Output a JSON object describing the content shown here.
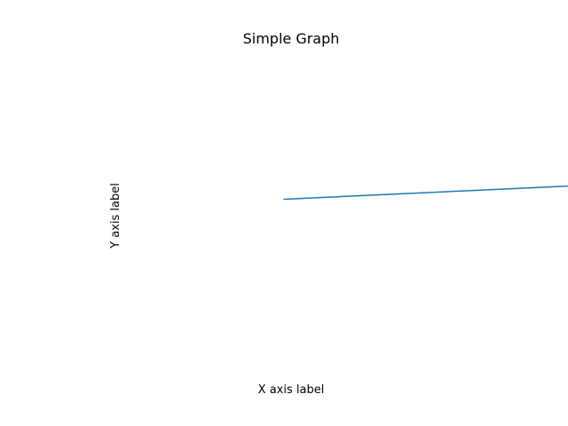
{
  "chart_data": {
    "type": "line",
    "title": "Simple Graph",
    "xlabel": "X axis label",
    "ylabel": "Y axis label",
    "grid": false,
    "series": [
      {
        "color": "#1f77b4",
        "x": [
          -1,
          0,
          1
        ],
        "y": [
          0.1,
          0.2,
          0.3
        ]
      }
    ],
    "xlim": [
      -1,
      1
    ],
    "ylim": [
      -1,
      1
    ]
  }
}
